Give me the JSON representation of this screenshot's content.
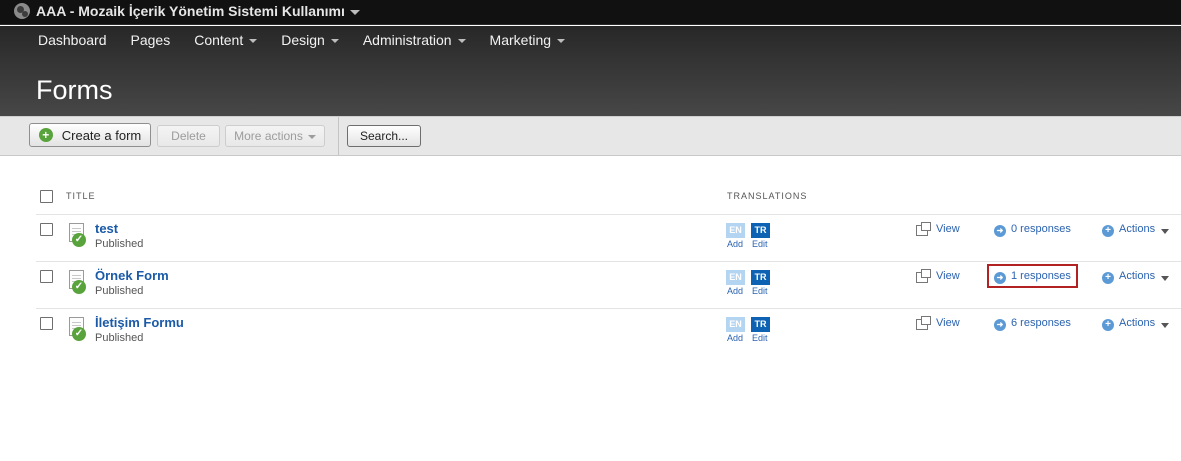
{
  "topbar": {
    "site_title": "AAA - Mozaik İçerik Yönetim Sistemi Kullanımı"
  },
  "nav": {
    "items": [
      {
        "label": "Dashboard",
        "has_menu": false
      },
      {
        "label": "Pages",
        "has_menu": false
      },
      {
        "label": "Content",
        "has_menu": true
      },
      {
        "label": "Design",
        "has_menu": true
      },
      {
        "label": "Administration",
        "has_menu": true
      },
      {
        "label": "Marketing",
        "has_menu": true
      }
    ]
  },
  "page": {
    "title": "Forms"
  },
  "toolbar": {
    "create_label": "Create a form",
    "delete_label": "Delete",
    "more_actions_label": "More actions",
    "search_label": "Search..."
  },
  "list": {
    "col_title": "TITLE",
    "col_translations": "TRANSLATIONS",
    "rows": [
      {
        "title": "test",
        "status": "Published",
        "lang_en": "EN",
        "lang_tr": "TR",
        "add_label": "Add",
        "edit_label": "Edit",
        "view_label": "View",
        "responses_label": "0 responses",
        "actions_label": "Actions"
      },
      {
        "title": "Örnek Form",
        "status": "Published",
        "lang_en": "EN",
        "lang_tr": "TR",
        "add_label": "Add",
        "edit_label": "Edit",
        "view_label": "View",
        "responses_label": "1 responses",
        "actions_label": "Actions"
      },
      {
        "title": "İletişim Formu",
        "status": "Published",
        "lang_en": "EN",
        "lang_tr": "TR",
        "add_label": "Add",
        "edit_label": "Edit",
        "view_label": "View",
        "responses_label": "6 responses",
        "actions_label": "Actions"
      }
    ]
  },
  "colors": {
    "accent_green": "#59a33c",
    "link_blue": "#2b63b0",
    "highlight_red": "#b22222",
    "lang_tr_blue": "#0e62b4",
    "lang_en_light": "#b4d5f2"
  },
  "icons": {
    "site": "globe-icon",
    "create": "plus-circle-icon",
    "form": "document-check-icon",
    "view": "external-window-icon",
    "responses": "arrow-circle-icon",
    "actions": "plus-circle-icon"
  }
}
